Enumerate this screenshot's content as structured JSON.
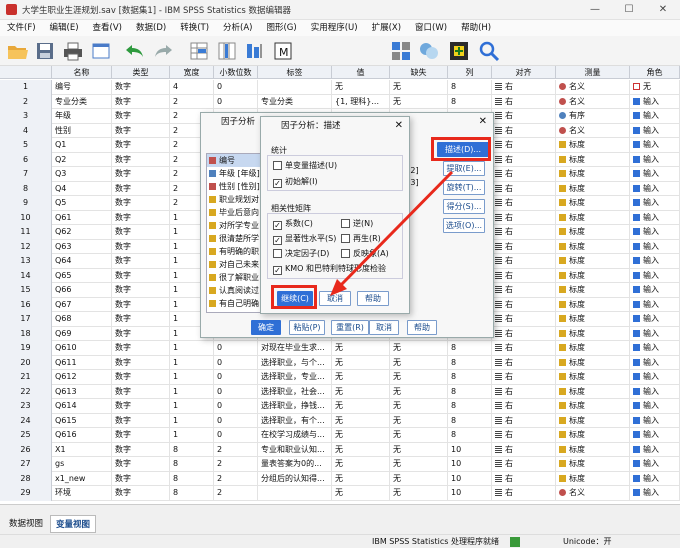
{
  "window": {
    "title": "大学生职业生涯规划.sav [数据集1] - IBM SPSS Statistics 数据编辑器",
    "minimize": "—",
    "maximize": "☐",
    "close": "✕"
  },
  "menu": [
    "文件(F)",
    "编辑(E)",
    "查看(V)",
    "数据(D)",
    "转换(T)",
    "分析(A)",
    "图形(G)",
    "实用程序(U)",
    "扩展(X)",
    "窗口(W)",
    "帮助(H)"
  ],
  "columns": [
    "",
    "名称",
    "类型",
    "宽度",
    "小数位数",
    "标签",
    "值",
    "缺失",
    "列",
    "对齐",
    "测量",
    "角色"
  ],
  "rows": [
    [
      "1",
      "编号",
      "数字",
      "4",
      "0",
      "",
      "无",
      "无",
      "8",
      "右",
      "名义",
      "无"
    ],
    [
      "2",
      "专业分类",
      "数字",
      "2",
      "0",
      "专业分类",
      "{1, 理科}...",
      "无",
      "8",
      "右",
      "名义",
      "输入"
    ],
    [
      "3",
      "年级",
      "数字",
      "2",
      "",
      "",
      "",
      "",
      "",
      "右",
      "有序",
      "输入"
    ],
    [
      "4",
      "性别",
      "数字",
      "2",
      "",
      "",
      "",
      "",
      "",
      "右",
      "名义",
      "输入"
    ],
    [
      "5",
      "Q1",
      "数字",
      "2",
      "",
      "",
      "",
      "",
      "",
      "右",
      "标度",
      "输入"
    ],
    [
      "6",
      "Q2",
      "数字",
      "2",
      "",
      "",
      "",
      "",
      "",
      "右",
      "标度",
      "输入"
    ],
    [
      "7",
      "Q3",
      "数字",
      "2",
      "",
      "",
      "",
      "",
      "",
      "右",
      "标度",
      "输入"
    ],
    [
      "8",
      "Q4",
      "数字",
      "2",
      "",
      "",
      "",
      "",
      "",
      "右",
      "标度",
      "输入"
    ],
    [
      "9",
      "Q5",
      "数字",
      "2",
      "",
      "",
      "",
      "",
      "",
      "右",
      "标度",
      "输入"
    ],
    [
      "10",
      "Q61",
      "数字",
      "1",
      "",
      "",
      "",
      "",
      "",
      "右",
      "标度",
      "输入"
    ],
    [
      "11",
      "Q62",
      "数字",
      "1",
      "",
      "",
      "",
      "",
      "",
      "右",
      "标度",
      "输入"
    ],
    [
      "12",
      "Q63",
      "数字",
      "1",
      "",
      "",
      "",
      "",
      "",
      "右",
      "标度",
      "输入"
    ],
    [
      "13",
      "Q64",
      "数字",
      "1",
      "",
      "",
      "",
      "",
      "",
      "右",
      "标度",
      "输入"
    ],
    [
      "14",
      "Q65",
      "数字",
      "1",
      "",
      "",
      "",
      "",
      "",
      "右",
      "标度",
      "输入"
    ],
    [
      "15",
      "Q66",
      "数字",
      "1",
      "",
      "",
      "",
      "",
      "",
      "右",
      "标度",
      "输入"
    ],
    [
      "16",
      "Q67",
      "数字",
      "1",
      "",
      "",
      "",
      "",
      "",
      "右",
      "标度",
      "输入"
    ],
    [
      "17",
      "Q68",
      "数字",
      "1",
      "",
      "",
      "",
      "",
      "",
      "右",
      "标度",
      "输入"
    ],
    [
      "18",
      "Q69",
      "数字",
      "1",
      "",
      "",
      "",
      "",
      "",
      "右",
      "标度",
      "输入"
    ],
    [
      "19",
      "Q610",
      "数字",
      "1",
      "0",
      "对现在毕业生求...",
      "无",
      "无",
      "8",
      "右",
      "标度",
      "输入"
    ],
    [
      "20",
      "Q611",
      "数字",
      "1",
      "0",
      "选择职业，与个...",
      "无",
      "无",
      "8",
      "右",
      "标度",
      "输入"
    ],
    [
      "21",
      "Q612",
      "数字",
      "1",
      "0",
      "选择职业，专业...",
      "无",
      "无",
      "8",
      "右",
      "标度",
      "输入"
    ],
    [
      "22",
      "Q613",
      "数字",
      "1",
      "0",
      "选择职业，社会...",
      "无",
      "无",
      "8",
      "右",
      "标度",
      "输入"
    ],
    [
      "23",
      "Q614",
      "数字",
      "1",
      "0",
      "选择职业，挣钱...",
      "无",
      "无",
      "8",
      "右",
      "标度",
      "输入"
    ],
    [
      "24",
      "Q615",
      "数字",
      "1",
      "0",
      "选择职业，有个...",
      "无",
      "无",
      "8",
      "右",
      "标度",
      "输入"
    ],
    [
      "25",
      "Q616",
      "数字",
      "1",
      "0",
      "在校学习成绩与...",
      "无",
      "无",
      "8",
      "右",
      "标度",
      "输入"
    ],
    [
      "26",
      "X1",
      "数字",
      "8",
      "2",
      "专业和职业认知...",
      "无",
      "无",
      "10",
      "右",
      "标度",
      "输入"
    ],
    [
      "27",
      "gs",
      "数字",
      "8",
      "2",
      "量表答案为0的...",
      "无",
      "无",
      "10",
      "右",
      "标度",
      "输入"
    ],
    [
      "28",
      "x1_new",
      "数字",
      "8",
      "2",
      "分组后的认知得...",
      "无",
      "无",
      "10",
      "右",
      "标度",
      "输入"
    ],
    [
      "29",
      "环境",
      "数字",
      "8",
      "2",
      "",
      "无",
      "无",
      "10",
      "右",
      "名义",
      "输入"
    ]
  ],
  "bottom_tabs": {
    "data_view": "数据视图",
    "variable_view": "变量视图"
  },
  "status": {
    "processor": "IBM SPSS Statistics 处理程序就绪",
    "unicode": "Unicode：开"
  },
  "factor_dialog": {
    "title": "因子分析",
    "vars": [
      "编号",
      "年级 [年级]",
      "性别 [性别]",
      "职业规划对",
      "毕业后意向",
      "对所学专业",
      "很清楚所学",
      "有明确的职",
      "对自己未来",
      "很了解职业",
      "认真阅读过",
      "有自己明确"
    ],
    "right_frag": [
      "1]",
      "[Q2]",
      "[Q3]"
    ],
    "side_buttons": [
      "描述(D)...",
      "提取(E)...",
      "旋转(T)...",
      "得分(S)...",
      "选项(O)..."
    ],
    "bottom_buttons": [
      "确定",
      "粘贴(P)",
      "重置(R)",
      "取消",
      "帮助"
    ]
  },
  "desc_dialog": {
    "title": "因子分析：描述",
    "stats_group": "统计",
    "stats": [
      {
        "label": "单变量描述(U)",
        "checked": false
      },
      {
        "label": "初始解(I)",
        "checked": true
      }
    ],
    "corr_group": "相关性矩阵",
    "corr": [
      {
        "label": "系数(C)",
        "checked": true
      },
      {
        "label": "逆(N)",
        "checked": false
      },
      {
        "label": "显著性水平(S)",
        "checked": true
      },
      {
        "label": "再生(R)",
        "checked": false
      },
      {
        "label": "决定因子(D)",
        "checked": false
      },
      {
        "label": "反映象(A)",
        "checked": false
      },
      {
        "label": "KMO 和巴特利特球形度检验",
        "checked": true
      }
    ],
    "buttons": [
      "继续(C)",
      "取消",
      "帮助"
    ]
  },
  "colors": {
    "accent": "#2f6fd6",
    "highlight": "#e8291c"
  }
}
